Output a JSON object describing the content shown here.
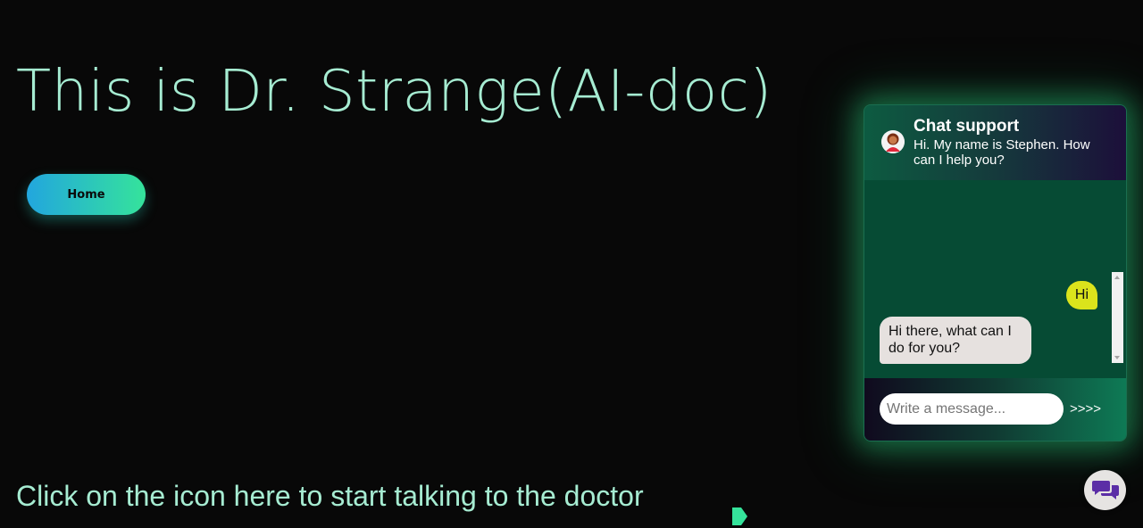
{
  "main": {
    "title": "This is Dr. Strange(AI-doc)",
    "home_button": "Home",
    "hint": "Click on the icon here to start talking to the doctor"
  },
  "chat": {
    "title": "Chat support",
    "subtitle": "Hi. My name is Stephen. How can I help you?",
    "messages": [
      {
        "from": "user",
        "text": "Hi"
      },
      {
        "from": "bot",
        "text": "Hi there, what can I do for you?"
      }
    ],
    "input_placeholder": "Write a message...",
    "send_label": ">>>>"
  },
  "icons": {
    "avatar": "doctor-avatar-icon",
    "arrow": "play-arrow-icon",
    "launcher": "chat-bubbles-icon"
  },
  "colors": {
    "accent_text": "#a6ecd2",
    "user_bubble": "#dbe31c",
    "bot_bubble": "#e6e1df",
    "chat_body": "#064b34",
    "launcher_icon": "#5b2ea6"
  }
}
